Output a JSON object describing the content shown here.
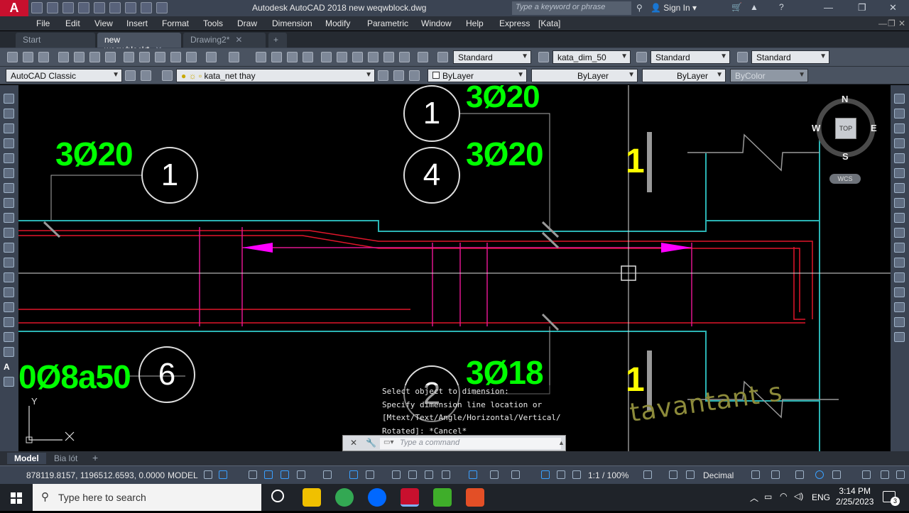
{
  "app": {
    "logo_letter": "A",
    "title": "Autodesk AutoCAD 2018    new weqwblock.dwg"
  },
  "search": {
    "placeholder": "Type a keyword or phrase"
  },
  "signin": {
    "label": "Sign In"
  },
  "menu": [
    "File",
    "Edit",
    "View",
    "Insert",
    "Format",
    "Tools",
    "Draw",
    "Dimension",
    "Modify",
    "Parametric",
    "Window",
    "Help",
    "Express",
    "[Kata]"
  ],
  "tabs": [
    {
      "label": "Start"
    },
    {
      "label": "new weqwblock*"
    },
    {
      "label": "Drawing2*"
    }
  ],
  "styles": {
    "text_style": "Standard",
    "dim_style": "kata_dim_50",
    "table_style": "Standard",
    "mleader_style": "Standard"
  },
  "workspace": "AutoCAD Classic",
  "layer": "kata_net thay",
  "properties": {
    "color": "ByLayer",
    "linetype": "ByLayer",
    "lineweight": "ByLayer",
    "plotstyle": "ByColor"
  },
  "viewcube": {
    "n": "N",
    "s": "S",
    "e": "E",
    "w": "W",
    "face": "TOP",
    "wcs": "WCS"
  },
  "drawing": {
    "labels_green": [
      "3Ø20",
      "3Ø20",
      "3Ø20",
      "0Ø8a50",
      "3Ø18"
    ],
    "bubbles": [
      "1",
      "1",
      "4",
      "6",
      "2"
    ],
    "labels_yellow": [
      "1",
      "1"
    ],
    "ucs_y": "Y",
    "watermark": "tavantant s"
  },
  "command": {
    "history": [
      "Select object to dimension:",
      "Specify dimension line location or",
      "[Mtext/Text/Angle/Horizontal/Vertical/",
      "Rotated]: *Cancel*"
    ],
    "placeholder": "Type a command"
  },
  "layout_tabs": [
    "Model",
    "Bia lót"
  ],
  "status": {
    "coords": "878119.8157, 1196512.6593, 0.0000",
    "space": "MODEL",
    "scale": "1:1 / 100%",
    "units": "Decimal"
  },
  "taskbar": {
    "search_placeholder": "Type here to search",
    "language": "ENG",
    "time": "3:14 PM",
    "date": "2/25/2023",
    "notification_count": "3"
  }
}
